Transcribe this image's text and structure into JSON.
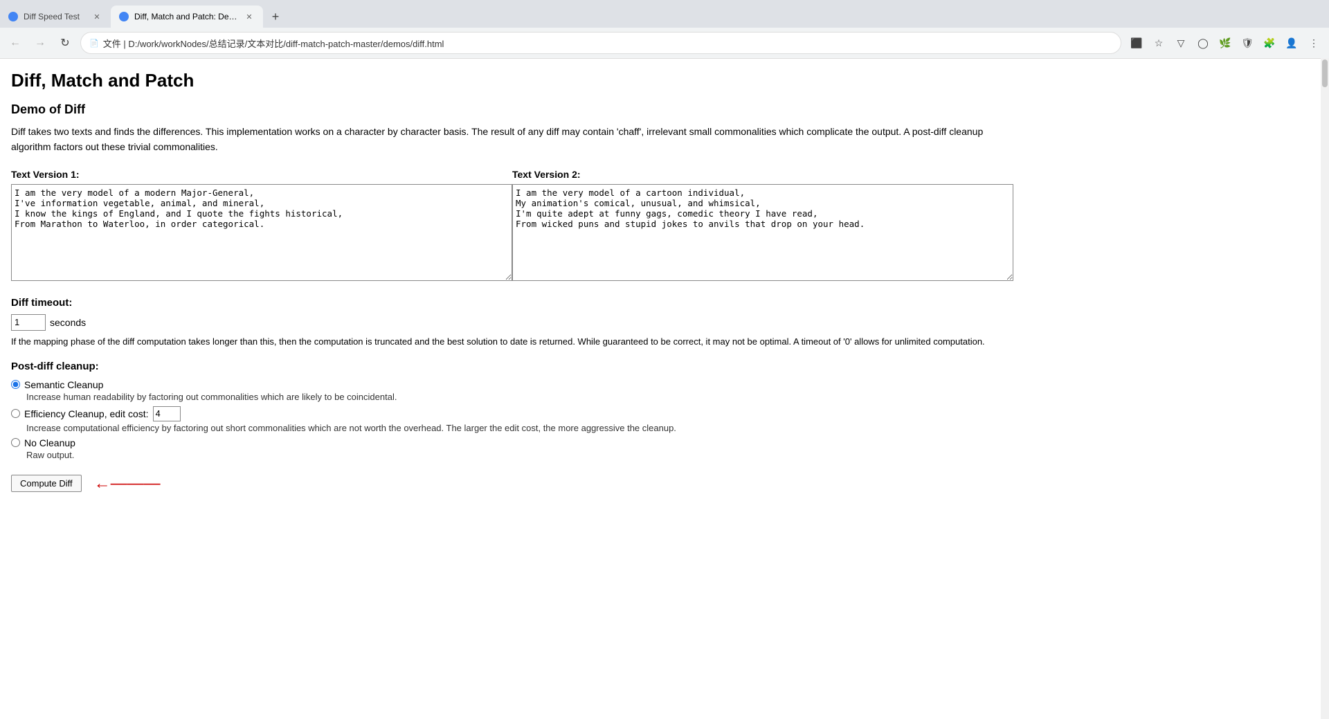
{
  "browser": {
    "tabs": [
      {
        "id": "tab1",
        "label": "Diff Speed Test",
        "active": false,
        "favicon_color": "#4285f4"
      },
      {
        "id": "tab2",
        "label": "Diff, Match and Patch: Demo …",
        "active": true,
        "favicon_color": "#4285f4"
      }
    ],
    "url": "D:/work/workNodes/总结记录/文本对比/diff-match-patch-master/demos/diff.html",
    "url_prefix": "文件 |"
  },
  "page": {
    "title": "Diff, Match and Patch",
    "demo_title": "Demo of Diff",
    "description": "Diff takes two texts and finds the differences. This implementation works on a character by character basis. The result of any diff may contain 'chaff', irrelevant small commonalities which complicate the output. A post-diff cleanup algorithm factors out these trivial commonalities.",
    "text1_label": "Text Version 1:",
    "text2_label": "Text Version 2:",
    "text1_value": "I am the very model of a modern Major-General,\nI've information vegetable, animal, and mineral,\nI know the kings of England, and I quote the fights historical,\nFrom Marathon to Waterloo, in order categorical.",
    "text2_value": "I am the very model of a cartoon individual,\nMy animation's comical, unusual, and whimsical,\nI'm quite adept at funny gags, comedic theory I have read,\nFrom wicked puns and stupid jokes to anvils that drop on your head.",
    "timeout_label": "Diff timeout:",
    "timeout_value": "1",
    "timeout_unit": "seconds",
    "timeout_desc": "If the mapping phase of the diff computation takes longer than this, then the computation is truncated and the best solution to date is returned. While guaranteed to be correct, it may not be optimal. A timeout of '0' allows for unlimited computation.",
    "cleanup_label": "Post-diff cleanup:",
    "radio_options": [
      {
        "id": "semantic",
        "label": "Semantic Cleanup",
        "checked": true,
        "desc": "Increase human readability by factoring out commonalities which are likely to be coincidental."
      },
      {
        "id": "efficiency",
        "label": "Efficiency Cleanup, edit cost:",
        "checked": false,
        "edit_cost": "4",
        "desc": "Increase computational efficiency by factoring out short commonalities which are not worth the overhead. The larger the edit cost, the more aggressive the cleanup."
      },
      {
        "id": "nocleanup",
        "label": "No Cleanup",
        "checked": false,
        "desc": "Raw output."
      }
    ],
    "compute_btn_label": "Compute Diff"
  }
}
